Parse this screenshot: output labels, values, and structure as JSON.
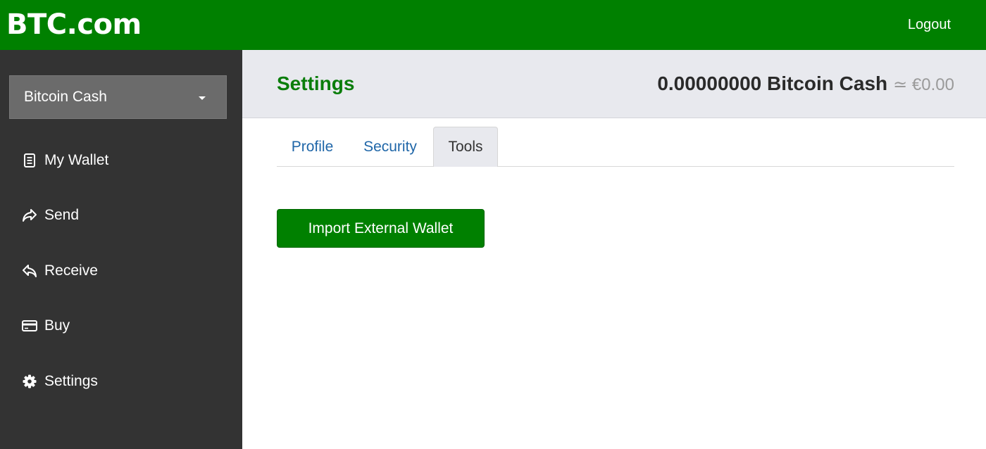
{
  "header": {
    "logo_text": "BTC.com",
    "logout_label": "Logout"
  },
  "sidebar": {
    "currency_select": {
      "value": "Bitcoin Cash"
    },
    "items": [
      {
        "label": "My Wallet",
        "icon": "wallet-icon"
      },
      {
        "label": "Send",
        "icon": "send-icon"
      },
      {
        "label": "Receive",
        "icon": "receive-icon"
      },
      {
        "label": "Buy",
        "icon": "credit-card-icon"
      },
      {
        "label": "Settings",
        "icon": "gear-icon"
      }
    ]
  },
  "main": {
    "title": "Settings",
    "balance": {
      "amount": "0.00000000 Bitcoin Cash",
      "fiat": "≃ €0.00"
    },
    "tabs": [
      {
        "label": "Profile",
        "active": false
      },
      {
        "label": "Security",
        "active": false
      },
      {
        "label": "Tools",
        "active": true
      }
    ],
    "import_button_label": "Import External Wallet"
  },
  "colors": {
    "brand_green": "#008000",
    "title_green": "#0a7d0a",
    "sidebar_bg": "#333333",
    "header_bg": "#e8e9ee",
    "tab_link": "#1f66a8"
  }
}
